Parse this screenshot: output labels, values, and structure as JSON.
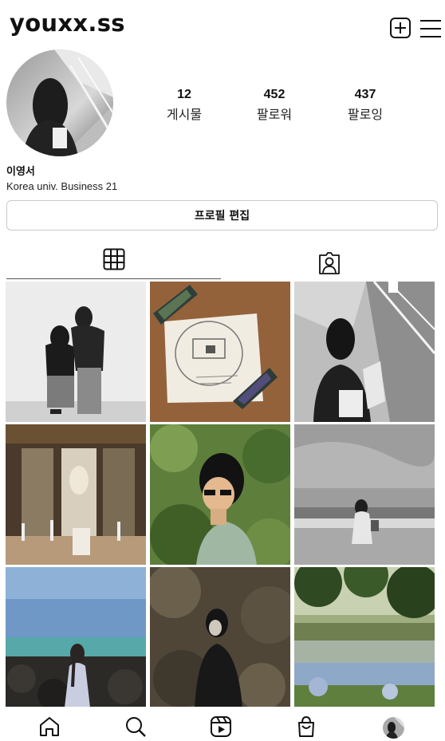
{
  "header": {
    "username": "youxx.ss",
    "add_icon": "plus-square-icon",
    "menu_icon": "hamburger-menu-icon"
  },
  "profile": {
    "display_name": "이영서",
    "bio": "Korea univ. Business 21",
    "edit_button_label": "프로필 편집",
    "stats": [
      {
        "value": "12",
        "label": "게시물"
      },
      {
        "value": "452",
        "label": "팔로워"
      },
      {
        "value": "437",
        "label": "팔로잉"
      }
    ]
  },
  "tabs": [
    {
      "name": "posts-grid",
      "icon": "grid-icon",
      "active": true
    },
    {
      "name": "tagged",
      "icon": "tagged-person-icon",
      "active": false
    }
  ],
  "posts": [
    {
      "id": "post-1",
      "desc": "couple-bw"
    },
    {
      "id": "post-2",
      "desc": "drawing-note"
    },
    {
      "id": "post-3",
      "desc": "subway-bw"
    },
    {
      "id": "post-4",
      "desc": "restaurant-interior"
    },
    {
      "id": "post-5",
      "desc": "sunglasses-greenery"
    },
    {
      "id": "post-6",
      "desc": "beach-bw"
    },
    {
      "id": "post-7",
      "desc": "seaside-rocks"
    },
    {
      "id": "post-8",
      "desc": "cave-dark"
    },
    {
      "id": "post-9",
      "desc": "lake-trees"
    }
  ],
  "bottom_nav": [
    {
      "name": "home",
      "icon": "home-icon"
    },
    {
      "name": "search",
      "icon": "search-icon"
    },
    {
      "name": "reels",
      "icon": "reels-icon"
    },
    {
      "name": "shop",
      "icon": "shopping-bag-icon"
    },
    {
      "name": "profile",
      "icon": "avatar-icon"
    }
  ],
  "colors": {
    "text": "#111111",
    "border": "#c9c9c9",
    "background": "#ffffff"
  }
}
